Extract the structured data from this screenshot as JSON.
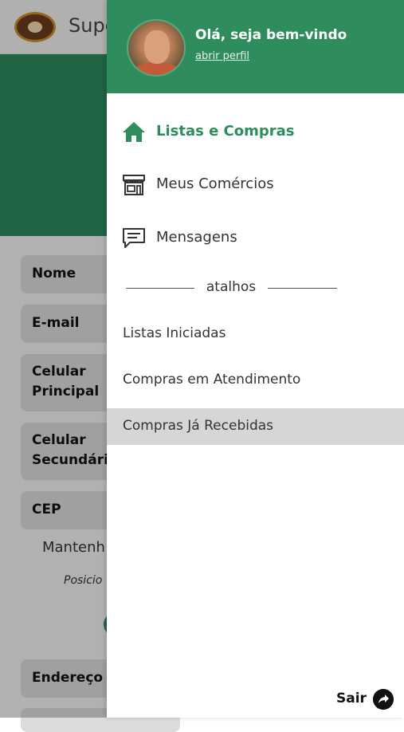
{
  "app": {
    "title": "Supe"
  },
  "form": {
    "fields": [
      "Nome",
      "E-mail",
      "Celular Principal",
      "Celular Secundário",
      "CEP",
      "Endereço"
    ],
    "cep_hint": "Mantenh",
    "position_hint": "Posicio"
  },
  "drawer": {
    "greeting": "Olá, seja bem-vindo",
    "profile_link": "abrir perfil",
    "menu": [
      {
        "label": "Listas e Compras",
        "icon": "home-icon",
        "active": true
      },
      {
        "label": "Meus Comércios",
        "icon": "store-icon",
        "active": false
      },
      {
        "label": "Mensagens",
        "icon": "message-icon",
        "active": false
      }
    ],
    "shortcuts_title": "atalhos",
    "shortcuts": [
      {
        "label": "Listas Iniciadas",
        "selected": false
      },
      {
        "label": "Compras em Atendimento",
        "selected": false
      },
      {
        "label": "Compras Já Recebidas",
        "selected": true
      }
    ],
    "logout_label": "Sair",
    "logout_icon": "exit-arrow-icon"
  },
  "colors": {
    "primary": "#2f8c5d",
    "selected_row": "#d6d6d6"
  }
}
